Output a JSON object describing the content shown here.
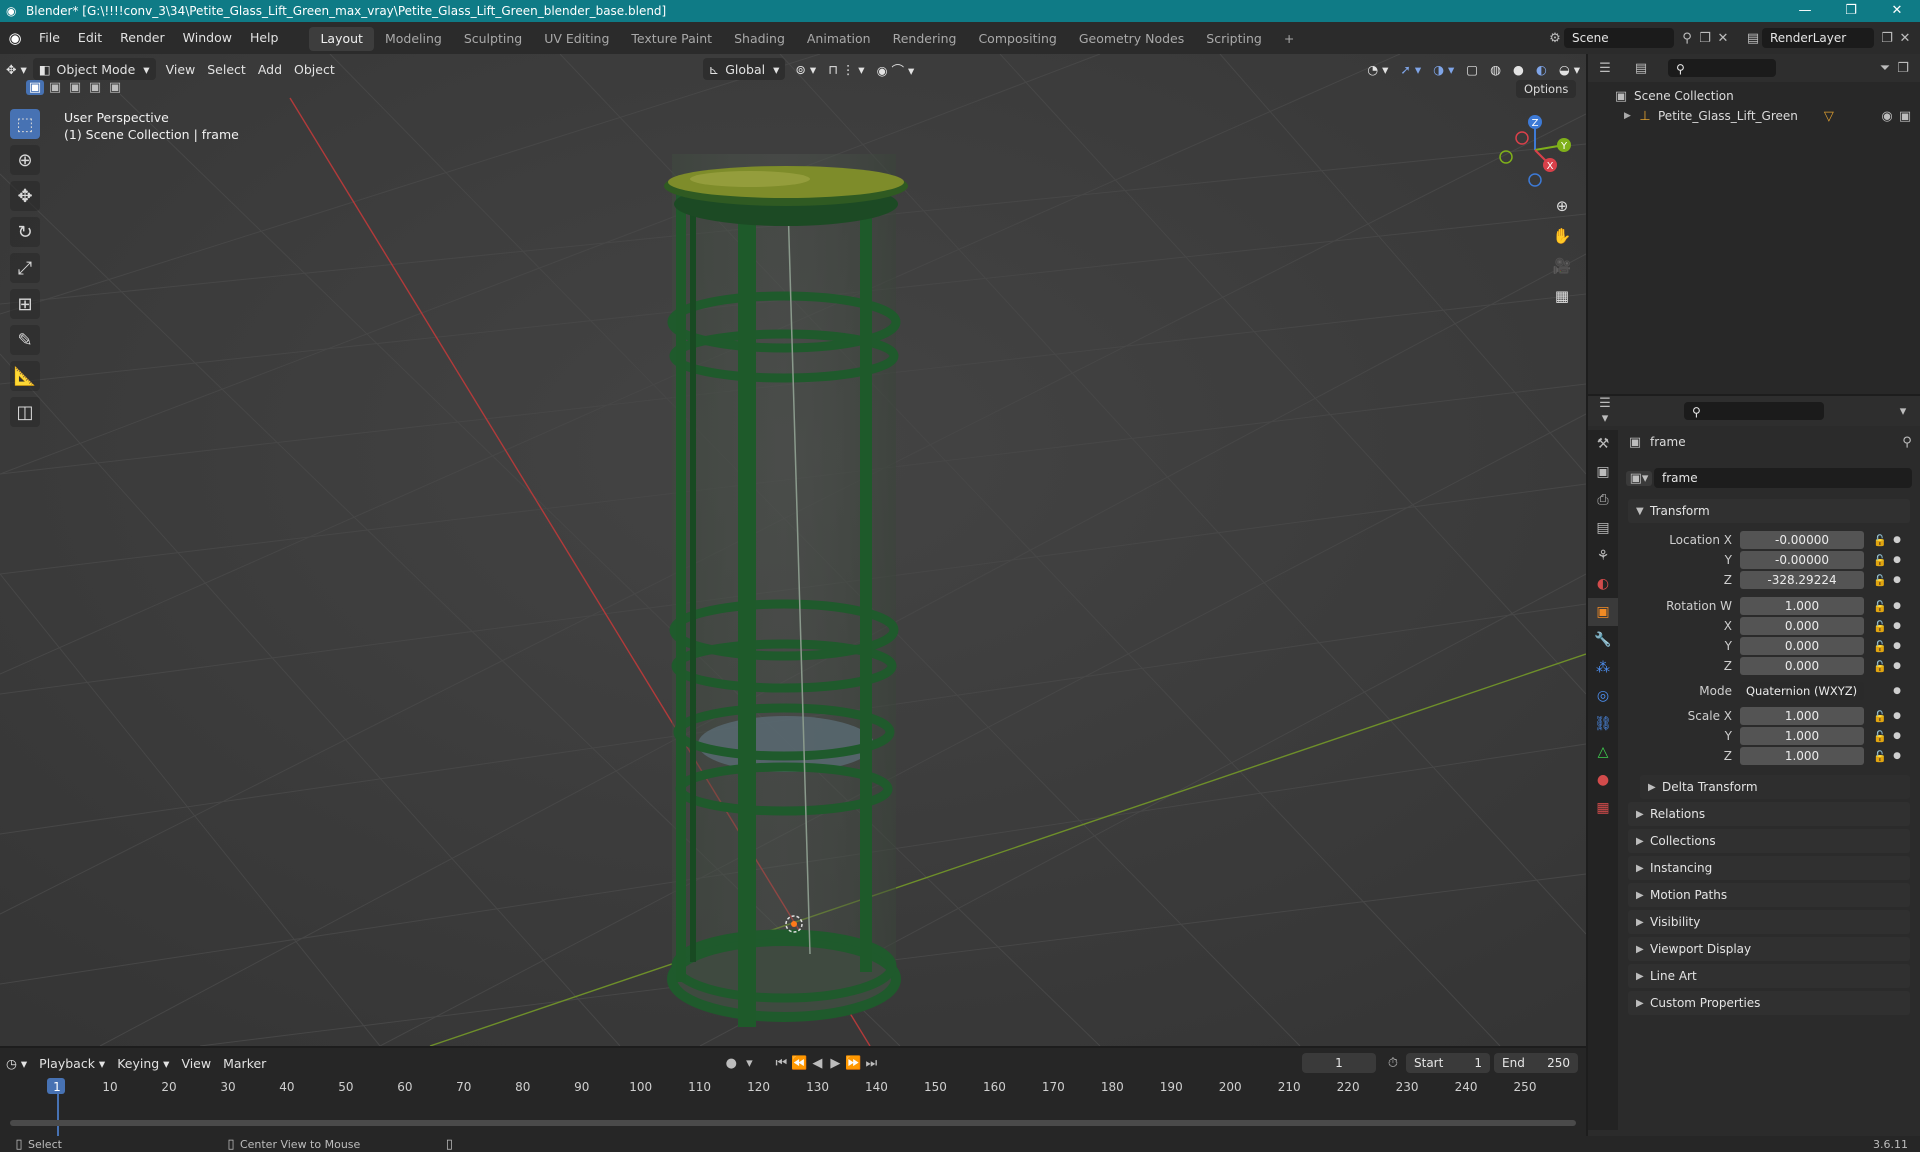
{
  "window": {
    "title": "Blender* [G:\\!!!!conv_3\\34\\Petite_Glass_Lift_Green_max_vray\\Petite_Glass_Lift_Green_blender_base.blend]",
    "minimize": "—",
    "maximize": "❐",
    "close": "✕"
  },
  "menus": [
    "File",
    "Edit",
    "Render",
    "Window",
    "Help"
  ],
  "workspaces": {
    "active": "Layout",
    "tabs": [
      "Layout",
      "Modeling",
      "Sculpting",
      "UV Editing",
      "Texture Paint",
      "Shading",
      "Animation",
      "Rendering",
      "Compositing",
      "Geometry Nodes",
      "Scripting"
    ],
    "add": "+"
  },
  "scene": {
    "name": "Scene",
    "render_layer": "RenderLayer"
  },
  "viewport": {
    "mode": "Object Mode",
    "menus": [
      "View",
      "Select",
      "Add",
      "Object"
    ],
    "orientation": "Global",
    "options_label": "Options",
    "perspective_label": "User Perspective",
    "collection_label": "(1) Scene Collection | frame",
    "gizmo": {
      "x": "X",
      "y": "Y",
      "z": "Z"
    }
  },
  "outliner": {
    "root": "Scene Collection",
    "items": [
      {
        "name": "Petite_Glass_Lift_Green"
      }
    ]
  },
  "properties": {
    "object_name": "frame",
    "data_name": "frame",
    "transform_label": "Transform",
    "location": {
      "label": "Location X",
      "x": "-0.00000",
      "y": "-0.00000",
      "z": "-328.29224"
    },
    "rotation": {
      "label": "Rotation W",
      "w": "1.000",
      "x": "0.000",
      "y": "0.000",
      "z": "0.000"
    },
    "mode_label": "Mode",
    "mode_value": "Quaternion (WXYZ)",
    "scale": {
      "label": "Scale X",
      "x": "1.000",
      "y": "1.000",
      "z": "1.000"
    },
    "axis_y": "Y",
    "axis_z": "Z",
    "axis_x": "X",
    "delta_transform": "Delta Transform",
    "panels": [
      "Relations",
      "Collections",
      "Instancing",
      "Motion Paths",
      "Visibility",
      "Viewport Display",
      "Line Art",
      "Custom Properties"
    ]
  },
  "timeline": {
    "menus": [
      "Playback",
      "Keying",
      "View",
      "Marker"
    ],
    "current_frame": "1",
    "start_label": "Start",
    "start": "1",
    "end_label": "End",
    "end": "250",
    "ticks": [
      "1",
      "10",
      "20",
      "30",
      "40",
      "50",
      "60",
      "70",
      "80",
      "90",
      "100",
      "110",
      "120",
      "130",
      "140",
      "150",
      "160",
      "170",
      "180",
      "190",
      "200",
      "210",
      "220",
      "230",
      "240",
      "250"
    ]
  },
  "status": {
    "left": "Select",
    "middle": "Center View to Mouse",
    "version": "3.6.11"
  },
  "colors": {
    "accent": "#4772b3",
    "title_bar": "#0f7b86",
    "lift_green": "#1f5a2c"
  }
}
